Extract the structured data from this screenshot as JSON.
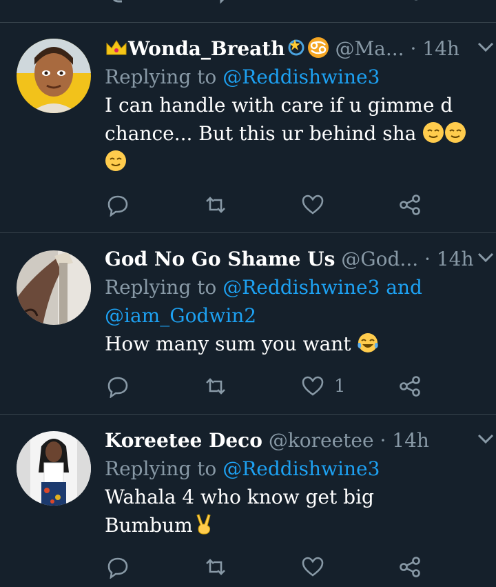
{
  "tweets": [
    {
      "display_name": "Wonda_Breath",
      "handle": "@Ma...",
      "separator": "·",
      "time": "14h",
      "reply_prefix": "Replying to",
      "reply_to": "@Reddishwine3",
      "reply_to_2": "",
      "body_line1": "I can handle with care if u gimme d",
      "body_line2": "chance... But this ur behind sha",
      "like_count": ""
    },
    {
      "display_name": "God No Go Shame Us",
      "handle": "@God...",
      "separator": "·",
      "time": "14h",
      "reply_prefix": "Replying to",
      "reply_to": "@Reddishwine3 and",
      "reply_to_2": "@iam_Godwin2",
      "body_line1": "How many sum you want",
      "like_count": "1"
    },
    {
      "display_name": "Koreetee Deco",
      "handle": "@koreetee",
      "separator": "·",
      "time": "14h",
      "reply_prefix": "Replying to",
      "reply_to": "@Reddishwine3",
      "reply_to_2": "",
      "body_line1": "Wahala 4 who know get big",
      "body_line2": "Bumbum",
      "like_count": ""
    }
  ],
  "icons": {
    "reply": "reply-icon",
    "retweet": "retweet-icon",
    "like": "heart-icon",
    "share": "share-icon",
    "caret": "chevron-down-icon"
  },
  "colors": {
    "background": "#15202b",
    "divider": "#38444d",
    "secondary_text": "#8899a6",
    "mention": "#1da1f2"
  }
}
